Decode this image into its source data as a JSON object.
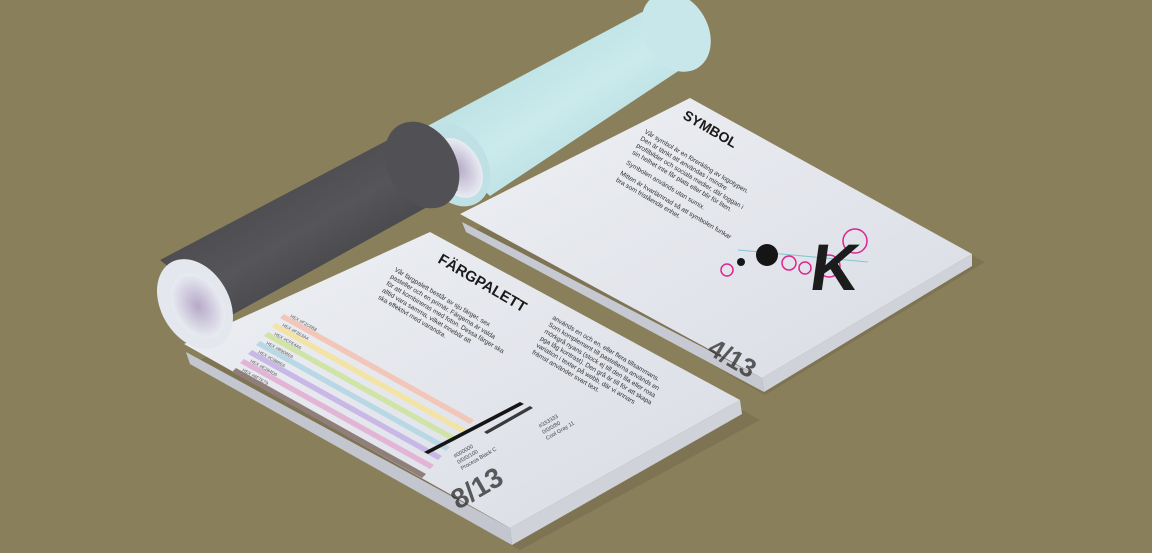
{
  "booklet_left": {
    "heading": "FÄRGPALETT",
    "body_lines": [
      "Vår färgpalett består av sju färger, sex",
      "pasteller och en primär. Färgerna är valda",
      "för att kombineras med foton. Dessa färger ska",
      "alltid vara samma, vilket innebär att",
      "ska effektivt med varandra."
    ],
    "swatches": [
      {
        "hex": "#f2c6b8",
        "label": "HEX #F2C6B8"
      },
      {
        "hex": "#f3e3a4",
        "label": "HEX #F3E3A4"
      },
      {
        "hex": "#cfe4a6",
        "label": "HEX #CFE4A6"
      },
      {
        "hex": "#b9d8e6",
        "label": "HEX #B9D8E6"
      },
      {
        "hex": "#c8b8e6",
        "label": "HEX #C8B8E6"
      },
      {
        "hex": "#e2b4d6",
        "label": "HEX #E2B4D6"
      },
      {
        "hex": "#8f7e79",
        "label": "HEX #8F7E79"
      }
    ],
    "right_column": [
      "används en och en, eller flera tillsammans.",
      "Som komplement till pastellerna används en",
      "mörkgrå nyans (stock ej till den lila eller rosa",
      "pga låg kontrast). Den grå är till för att skapa",
      "variation i texter på webb, där vi annars",
      "främst använder svart text."
    ],
    "specs": [
      "#000000",
      "0/0/0/100",
      "Process Black C",
      "#333333",
      "0/0/0/80",
      "Cool Gray 11"
    ],
    "page_number": "8/13"
  },
  "booklet_right": {
    "heading": "SYMBOL",
    "body_lines": [
      "Vår symbol är en förenkling av logotypen.",
      "Den är tänkt att användas i mindre",
      "profilbilder och sociala medier, där loggan i",
      "sin helhet inte får plats eller blir för liten.",
      "Symbolen används utan sumix.",
      "Mitten är kvarlämnad så att symbolen funkar",
      "bra som fristående enhet."
    ],
    "symbol_letter": "K",
    "page_number": "4/13"
  },
  "colors": {
    "background": "#8a7f5b",
    "paper": "#e6e8ee",
    "roll_dark": "#4a4a4e",
    "roll_light": "#bfe3e6",
    "accent_pink": "#e0248f"
  }
}
